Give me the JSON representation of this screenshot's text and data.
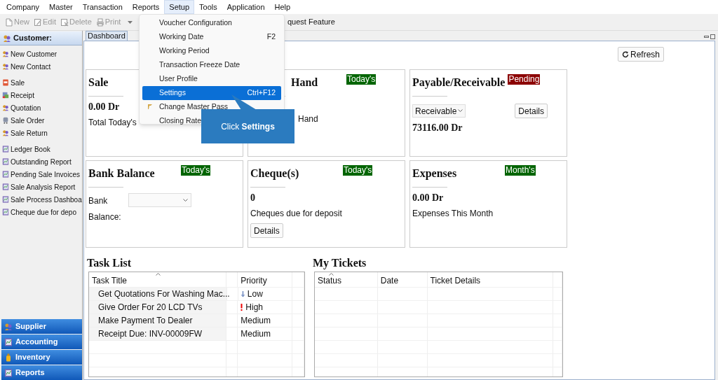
{
  "menu_bar": [
    {
      "label": "Company",
      "selected": false
    },
    {
      "label": "Master",
      "selected": false
    },
    {
      "label": "Transaction",
      "selected": false
    },
    {
      "label": "Reports",
      "selected": false
    },
    {
      "label": "Setup",
      "selected": true
    },
    {
      "label": "Tools",
      "selected": false
    },
    {
      "label": "Application",
      "selected": false
    },
    {
      "label": "Help",
      "selected": false
    }
  ],
  "toolbar": {
    "buttons": [
      {
        "label": "New",
        "kind": "new"
      },
      {
        "label": "Edit",
        "kind": "edit"
      },
      {
        "label": "Delete",
        "kind": "delete"
      },
      {
        "label": "Print",
        "kind": "print"
      }
    ],
    "right_text": "quest Feature"
  },
  "setup_menu": [
    {
      "label": "Voucher Configuration",
      "icon": false,
      "selected": false
    },
    {
      "label": "Working Date",
      "shortcut": "F2",
      "icon": false,
      "selected": false
    },
    {
      "label": "Working Period",
      "icon": false,
      "selected": false
    },
    {
      "label": "Transaction Freeze Date",
      "icon": false,
      "selected": false
    },
    {
      "label": "User Profile",
      "icon": false,
      "selected": false
    },
    {
      "label": "Settings",
      "shortcut": "Ctrl+F12",
      "icon": false,
      "selected": true
    },
    {
      "label": "Change Master Pass",
      "icon": true,
      "selected": false
    },
    {
      "label": "Closing Rate",
      "icon": false,
      "selected": false
    }
  ],
  "callout": "Click **Settings**",
  "sidebar": {
    "header": "Customer:",
    "groups": [
      [
        {
          "label": "New Customer",
          "kind": "people"
        },
        {
          "label": "New Contact",
          "kind": "people"
        }
      ],
      [
        {
          "label": "Sale",
          "kind": "sale"
        },
        {
          "label": "Receipt",
          "kind": "receipt"
        },
        {
          "label": "Quotation",
          "kind": "people"
        },
        {
          "label": "Sale Order",
          "kind": "order"
        },
        {
          "label": "Sale Return",
          "kind": "people"
        }
      ],
      [
        {
          "label": "Ledger Book",
          "kind": "report"
        },
        {
          "label": "Outstanding Report",
          "kind": "report"
        },
        {
          "label": "Pending Sale Invoices",
          "kind": "report"
        },
        {
          "label": "Sale Analysis Report",
          "kind": "report"
        },
        {
          "label": "Sale Process Dashboa",
          "kind": "report"
        },
        {
          "label": "Cheque due for depo",
          "kind": "report"
        }
      ]
    ],
    "sections": [
      {
        "label": "Supplier",
        "kind": "people"
      },
      {
        "label": "Accounting",
        "kind": "report"
      },
      {
        "label": "Inventory",
        "kind": "bottle"
      },
      {
        "label": "Reports",
        "kind": "report"
      }
    ]
  },
  "tab": {
    "label": "Dashboard",
    "selected": true
  },
  "refresh_button": "Refresh",
  "cards": [
    {
      "title": "Sale",
      "body": [
        {
          "kind": "amount",
          "text": "0.00 Dr"
        },
        {
          "kind": "text",
          "text": "Total Today's"
        }
      ]
    },
    {
      "title": "Hand",
      "badge": {
        "text": "Today's",
        "color": "#006400"
      },
      "body": [
        {
          "kind": "text",
          "text": "Hand"
        }
      ]
    },
    {
      "title": "Payable/Receivable",
      "badge": {
        "text": "Pending",
        "color": "#8b0000"
      },
      "body": [
        {
          "kind": "select_button",
          "value": "Receivable",
          "button": "Details"
        },
        {
          "kind": "amount",
          "text": "73116.00 Dr"
        }
      ]
    },
    {
      "title": "Bank Balance",
      "badge": {
        "text": "Today's",
        "color": "#006400"
      },
      "body": [
        {
          "kind": "select_field",
          "label": "Bank"
        },
        {
          "kind": "text",
          "text": "Balance:"
        }
      ]
    },
    {
      "title": "Cheque(s)",
      "badge": {
        "text": "Today's",
        "color": "#006400"
      },
      "body": [
        {
          "kind": "amount",
          "text": "0"
        },
        {
          "kind": "text",
          "text": "Cheques due for deposit"
        },
        {
          "kind": "button",
          "text": "Details"
        }
      ]
    },
    {
      "title": "Expenses",
      "badge": {
        "text": "Month's",
        "color": "#006400"
      },
      "body": [
        {
          "kind": "amount",
          "text": "0.00 Dr"
        },
        {
          "kind": "text",
          "text": "Expenses This Month"
        }
      ]
    }
  ],
  "task_list": {
    "title": "Task List",
    "columns": [
      {
        "label": "Task Title",
        "sorted": true
      },
      {
        "label": "Priority",
        "sorted": false
      }
    ],
    "rows": [
      {
        "title": "Get Quotations For Washing Mac...",
        "priority": "Low",
        "kind": "low"
      },
      {
        "title": "Give Order For 20 LCD TVs",
        "priority": "High",
        "kind": "high"
      },
      {
        "title": "Make Payment To Dealer",
        "priority": "Medium",
        "kind": "medium"
      },
      {
        "title": "Receipt Due: INV-00009FW",
        "priority": "Medium",
        "kind": "medium"
      }
    ]
  },
  "my_tickets": {
    "title": "My Tickets",
    "columns": [
      {
        "label": "Status",
        "sorted": true
      },
      {
        "label": "Date",
        "sorted": false
      },
      {
        "label": "Ticket Details",
        "sorted": false
      }
    ]
  }
}
